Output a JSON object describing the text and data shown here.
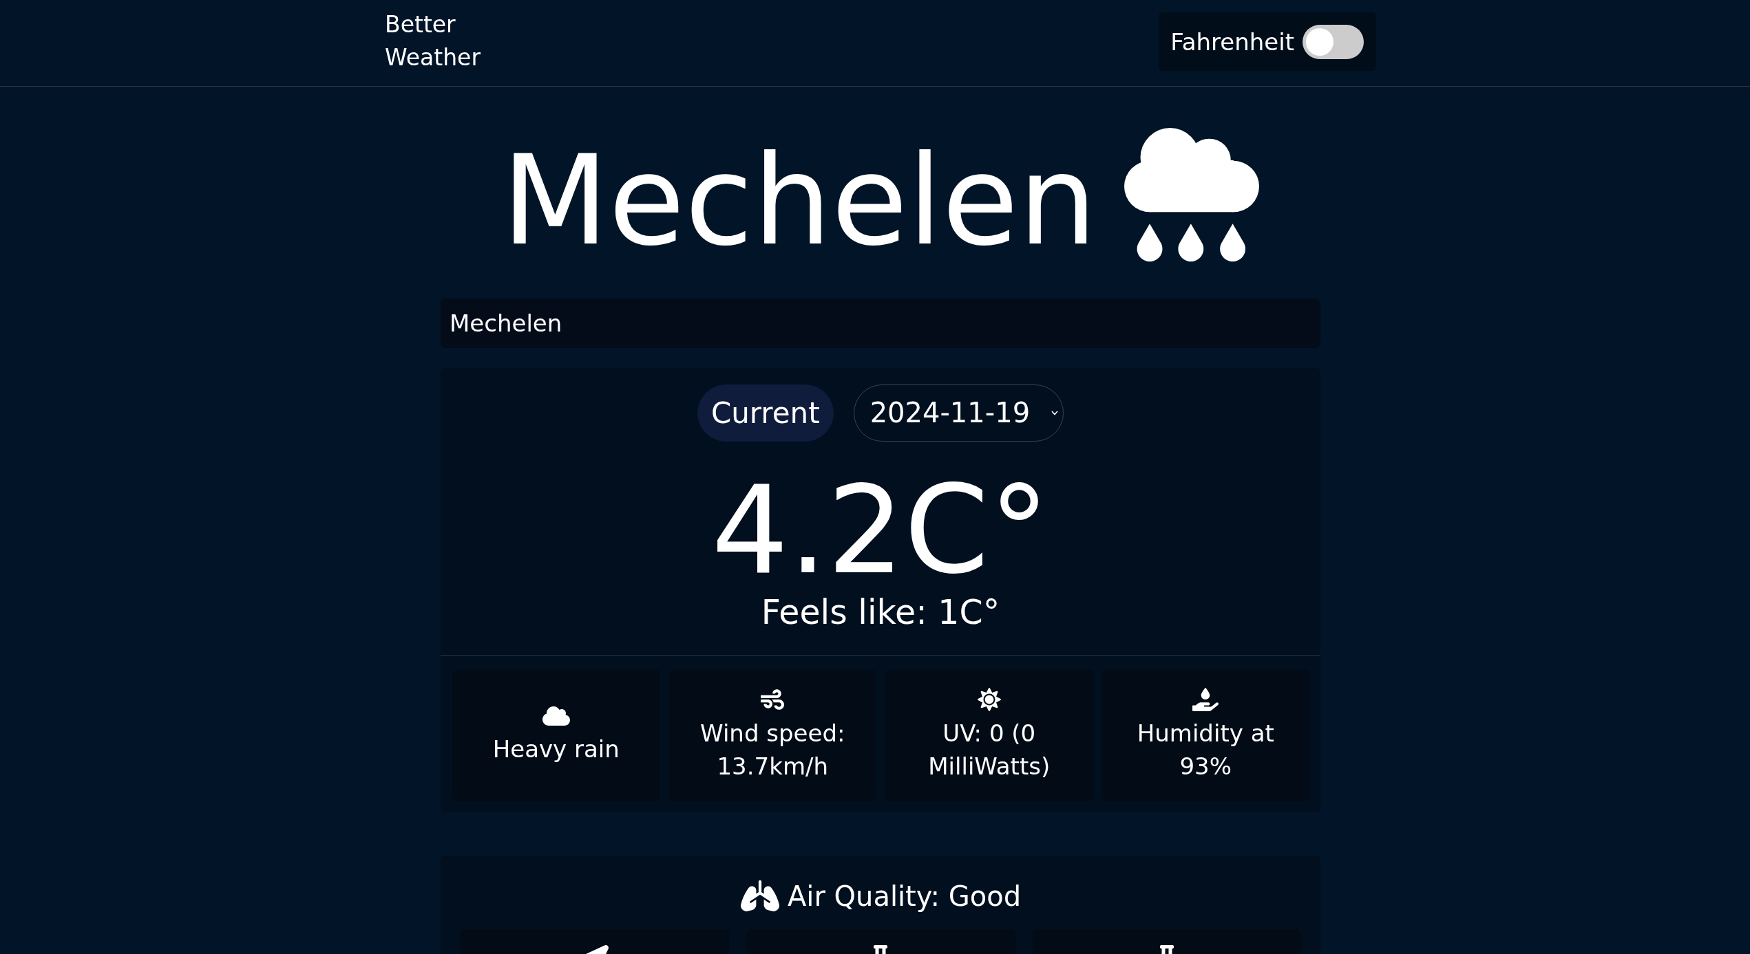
{
  "header": {
    "brand": "Better Weather",
    "unit_toggle": {
      "label": "Fahrenheit",
      "on": false
    }
  },
  "location": {
    "city": "Mechelen"
  },
  "search": {
    "value": "Mechelen"
  },
  "forecast": {
    "current_button": {
      "label": "Current",
      "selected": true
    },
    "date_select": {
      "value": "2024-11-19"
    },
    "temperature": "4.2C°",
    "feels_like": "Feels like: 1C°",
    "details": [
      {
        "kind": "condition",
        "text": "Heavy rain"
      },
      {
        "kind": "wind",
        "text": "Wind speed: 13.7km/h"
      },
      {
        "kind": "uv",
        "text": "UV: 0 (0 MilliWatts)"
      },
      {
        "kind": "humidity",
        "text": "Humidity at 93%"
      }
    ]
  },
  "air_quality": {
    "title": "Air Quality: Good",
    "tiles": [
      {
        "kind": "arrow"
      },
      {
        "kind": "flask"
      },
      {
        "kind": "flask"
      }
    ]
  }
}
